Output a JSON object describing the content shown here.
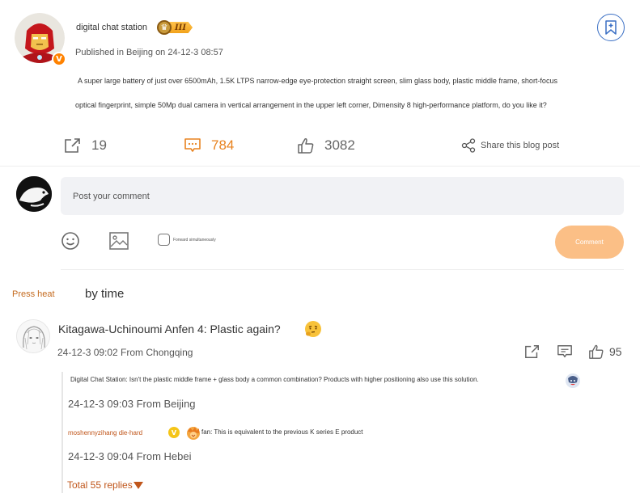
{
  "post": {
    "author": "digital chat station",
    "rank_label": "III",
    "published": "Published in Beijing on 24-12-3 08:57",
    "text_line1": "A super large battery of just over 6500mAh, 1.5K LTPS narrow-edge eye-protection straight screen, slim glass body, plastic middle frame, short-focus",
    "text_line2": "optical fingerprint, simple 50Mp dual camera in vertical arrangement in the upper left corner, Dimensity 8 high-performance platform, do you like it?",
    "verified_badge": "V"
  },
  "actions": {
    "reposts": "19",
    "comments": "784",
    "likes": "3082",
    "share_label": "Share this blog post"
  },
  "composer": {
    "placeholder": "Post your comment",
    "forward_label": "Forward simultaneously",
    "submit_label": "Comment"
  },
  "sort": {
    "heat": "Press heat",
    "time": "by time"
  },
  "comments": [
    {
      "text": "Kitagawa-Uchinoumi Anfen 4: Plastic again?",
      "meta": "24-12-3 09:02 From Chongqing",
      "likes": "95",
      "replies": [
        {
          "text": "Digital Chat Station: Isn't the plastic middle frame + glass body a common combination? Products with higher positioning also use this solution.",
          "meta": "24-12-3 09:03 From Beijing"
        },
        {
          "name": "moshennyzihang die-hard",
          "badge": "V",
          "text": "fan: This is equivalent to the previous K series E product",
          "meta": "24-12-3 09:04 From Hebei"
        }
      ],
      "total_replies": "Total 55 replies"
    }
  ],
  "colors": {
    "accent_orange": "#e8821e",
    "reply_name": "#c0561b",
    "bookmark_blue": "#3a6fc4",
    "submit_button": "#fbbf86"
  }
}
